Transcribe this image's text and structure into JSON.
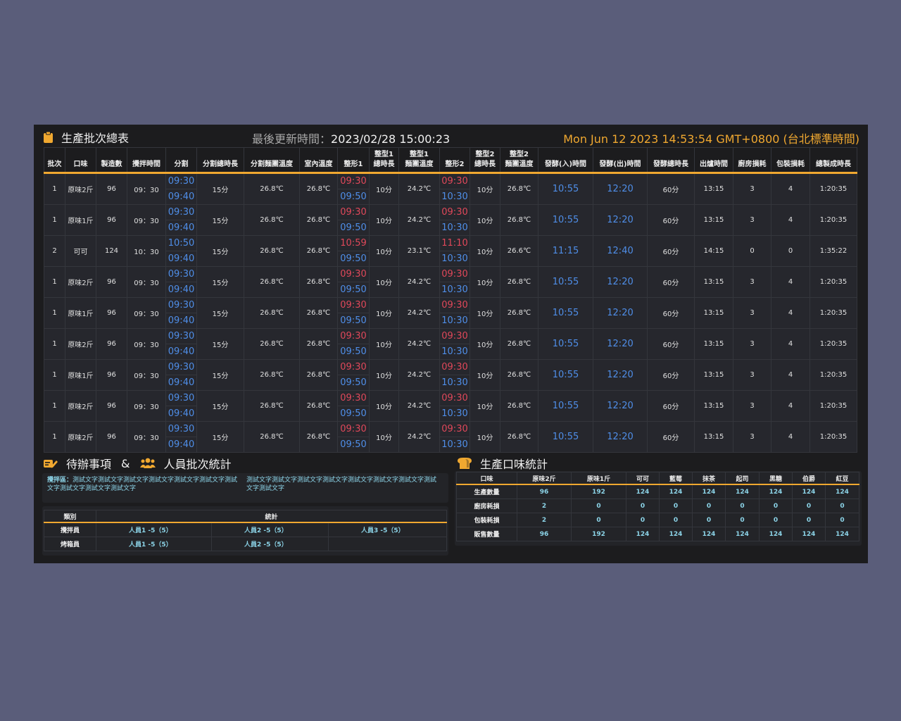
{
  "header": {
    "title": "生產批次總表",
    "last_update_label": "最後更新時間：",
    "last_update_value": "2023/02/28 15:00:23",
    "clock": "Mon Jun 12 2023 14:53:54 GMT+0800 (台北標準時間)"
  },
  "columns": [
    "批次",
    "口味",
    "製造數",
    "攪拌時間",
    "分割",
    "分割總時長",
    "分割麵團溫度",
    "室內溫度",
    "整形1",
    "整型1 總時長",
    "整型1 麵團溫度",
    "整形2",
    "整型2 總時長",
    "整型2 麵團溫度",
    "發酵(入)時間",
    "發酵(出)時間",
    "發酵總時長",
    "出爐時間",
    "廚房損耗",
    "包裝損耗",
    "總製成時長"
  ],
  "rows": [
    {
      "batch": "1",
      "flavor": "原味2斤",
      "qty": "96",
      "mix": "09：30",
      "div1": "09:30",
      "div2": "09:40",
      "div_dur": "15分",
      "div_temp": "26.8℃",
      "room": "26.8℃",
      "s1a": "09:30",
      "s1b": "09:50",
      "s1_dur": "10分",
      "s1_temp": "24.2℃",
      "s2a": "09:30",
      "s2b": "10:30",
      "s2_dur": "10分",
      "s2_temp": "26.8℃",
      "fin": "10:55",
      "fout": "12:20",
      "f_dur": "60分",
      "oven": "13:15",
      "kloss": "3",
      "ploss": "4",
      "total": "1:20:35"
    },
    {
      "batch": "1",
      "flavor": "原味1斤",
      "qty": "96",
      "mix": "09：30",
      "div1": "09:30",
      "div2": "09:40",
      "div_dur": "15分",
      "div_temp": "26.8℃",
      "room": "26.8℃",
      "s1a": "09:30",
      "s1b": "09:50",
      "s1_dur": "10分",
      "s1_temp": "24.2℃",
      "s2a": "09:30",
      "s2b": "10:30",
      "s2_dur": "10分",
      "s2_temp": "26.8℃",
      "fin": "10:55",
      "fout": "12:20",
      "f_dur": "60分",
      "oven": "13:15",
      "kloss": "3",
      "ploss": "4",
      "total": "1:20:35"
    },
    {
      "batch": "2",
      "flavor": "可可",
      "qty": "124",
      "mix": "10：30",
      "div1": "10:50",
      "div2": "09:40",
      "div_dur": "15分",
      "div_temp": "26.8℃",
      "room": "26.8℃",
      "s1a": "10:59",
      "s1b": "09:50",
      "s1_dur": "10分",
      "s1_temp": "23.1℃",
      "s2a": "11:10",
      "s2b": "10:30",
      "s2_dur": "10分",
      "s2_temp": "26.6℃",
      "fin": "11:15",
      "fout": "12:40",
      "f_dur": "60分",
      "oven": "14:15",
      "kloss": "0",
      "ploss": "0",
      "total": "1:35:22"
    },
    {
      "batch": "1",
      "flavor": "原味2斤",
      "qty": "96",
      "mix": "09：30",
      "div1": "09:30",
      "div2": "09:40",
      "div_dur": "15分",
      "div_temp": "26.8℃",
      "room": "26.8℃",
      "s1a": "09:30",
      "s1b": "09:50",
      "s1_dur": "10分",
      "s1_temp": "24.2℃",
      "s2a": "09:30",
      "s2b": "10:30",
      "s2_dur": "10分",
      "s2_temp": "26.8℃",
      "fin": "10:55",
      "fout": "12:20",
      "f_dur": "60分",
      "oven": "13:15",
      "kloss": "3",
      "ploss": "4",
      "total": "1:20:35"
    },
    {
      "batch": "1",
      "flavor": "原味1斤",
      "qty": "96",
      "mix": "09：30",
      "div1": "09:30",
      "div2": "09:40",
      "div_dur": "15分",
      "div_temp": "26.8℃",
      "room": "26.8℃",
      "s1a": "09:30",
      "s1b": "09:50",
      "s1_dur": "10分",
      "s1_temp": "24.2℃",
      "s2a": "09:30",
      "s2b": "10:30",
      "s2_dur": "10分",
      "s2_temp": "26.8℃",
      "fin": "10:55",
      "fout": "12:20",
      "f_dur": "60分",
      "oven": "13:15",
      "kloss": "3",
      "ploss": "4",
      "total": "1:20:35"
    },
    {
      "batch": "1",
      "flavor": "原味2斤",
      "qty": "96",
      "mix": "09：30",
      "div1": "09:30",
      "div2": "09:40",
      "div_dur": "15分",
      "div_temp": "26.8℃",
      "room": "26.8℃",
      "s1a": "09:30",
      "s1b": "09:50",
      "s1_dur": "10分",
      "s1_temp": "24.2℃",
      "s2a": "09:30",
      "s2b": "10:30",
      "s2_dur": "10分",
      "s2_temp": "26.8℃",
      "fin": "10:55",
      "fout": "12:20",
      "f_dur": "60分",
      "oven": "13:15",
      "kloss": "3",
      "ploss": "4",
      "total": "1:20:35"
    },
    {
      "batch": "1",
      "flavor": "原味1斤",
      "qty": "96",
      "mix": "09：30",
      "div1": "09:30",
      "div2": "09:40",
      "div_dur": "15分",
      "div_temp": "26.8℃",
      "room": "26.8℃",
      "s1a": "09:30",
      "s1b": "09:50",
      "s1_dur": "10分",
      "s1_temp": "24.2℃",
      "s2a": "09:30",
      "s2b": "10:30",
      "s2_dur": "10分",
      "s2_temp": "26.8℃",
      "fin": "10:55",
      "fout": "12:20",
      "f_dur": "60分",
      "oven": "13:15",
      "kloss": "3",
      "ploss": "4",
      "total": "1:20:35"
    },
    {
      "batch": "1",
      "flavor": "原味2斤",
      "qty": "96",
      "mix": "09：30",
      "div1": "09:30",
      "div2": "09:40",
      "div_dur": "15分",
      "div_temp": "26.8℃",
      "room": "26.8℃",
      "s1a": "09:30",
      "s1b": "09:50",
      "s1_dur": "10分",
      "s1_temp": "24.2℃",
      "s2a": "09:30",
      "s2b": "10:30",
      "s2_dur": "10分",
      "s2_temp": "26.8℃",
      "fin": "10:55",
      "fout": "12:20",
      "f_dur": "60分",
      "oven": "13:15",
      "kloss": "3",
      "ploss": "4",
      "total": "1:20:35"
    },
    {
      "batch": "1",
      "flavor": "原味2斤",
      "qty": "96",
      "mix": "09：30",
      "div1": "09:30",
      "div2": "09:40",
      "div_dur": "15分",
      "div_temp": "26.8℃",
      "room": "26.8℃",
      "s1a": "09:30",
      "s1b": "09:50",
      "s1_dur": "10分",
      "s1_temp": "24.2℃",
      "s2a": "09:30",
      "s2b": "10:30",
      "s2_dur": "10分",
      "s2_temp": "26.8℃",
      "fin": "10:55",
      "fout": "12:20",
      "f_dur": "60分",
      "oven": "13:15",
      "kloss": "3",
      "ploss": "4",
      "total": "1:20:35"
    }
  ],
  "todo": {
    "title": "待辦事項",
    "amp": "&",
    "staff_title": "人員批次統計",
    "label": "攪拌區：",
    "text_a": "測試文字測試文字測試文字測試文字測試文字測試文字測試文字測試文字測試文字測試文字",
    "text_b": "測試文字測試文字測試文字測試文字測試文字測試文字測試文字測試文字測試文字"
  },
  "staff": {
    "headers": [
      "類別",
      "統計"
    ],
    "rows": [
      {
        "cat": "攪拌員",
        "cells": [
          "人員1 -5（5）",
          "人員2 -5（5）",
          "人員3 -5（5）"
        ]
      },
      {
        "cat": "烤箱員",
        "cells": [
          "人員1 -5（5）",
          "人員2 -5（5）",
          ""
        ]
      }
    ]
  },
  "flavor_stats": {
    "title": "生產口味統計",
    "headers": [
      "口味",
      "原味2斤",
      "原味1斤",
      "可可",
      "藍莓",
      "抹茶",
      "起司",
      "黑糖",
      "伯爵",
      "紅豆"
    ],
    "rows": [
      {
        "label": "生產數量",
        "values": [
          "96",
          "192",
          "124",
          "124",
          "124",
          "124",
          "124",
          "124",
          "124"
        ]
      },
      {
        "label": "廚房耗損",
        "values": [
          "2",
          "0",
          "0",
          "0",
          "0",
          "0",
          "0",
          "0",
          "0"
        ]
      },
      {
        "label": "包裝耗損",
        "values": [
          "2",
          "0",
          "0",
          "0",
          "0",
          "0",
          "0",
          "0",
          "0"
        ]
      },
      {
        "label": "販售數量",
        "values": [
          "96",
          "192",
          "124",
          "124",
          "124",
          "124",
          "124",
          "124",
          "124"
        ]
      }
    ]
  },
  "colors": {
    "accent": "#f0a830",
    "blue": "#4f8ee8",
    "red": "#e0485a",
    "teal": "#8cd4e8"
  }
}
